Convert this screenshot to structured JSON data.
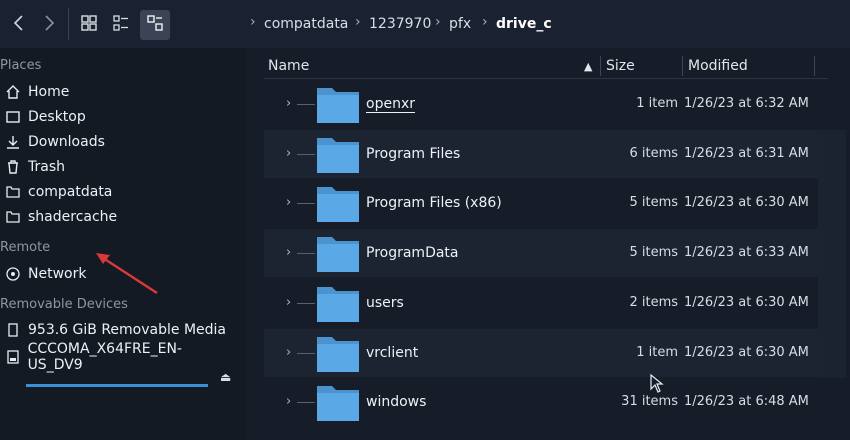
{
  "toolbar": {
    "back_icon": "chevron-left",
    "forward_icon": "chevron-right",
    "view_icons_icon": "icons-view",
    "view_compact_icon": "compact-view",
    "view_details_icon": "details-view"
  },
  "breadcrumb": [
    "compatdata",
    "1237970",
    "pfx",
    "drive_c"
  ],
  "sidebar": {
    "places_title": "Places",
    "places": [
      {
        "label": "Home",
        "icon": "home-icon"
      },
      {
        "label": "Desktop",
        "icon": "desktop-icon"
      },
      {
        "label": "Downloads",
        "icon": "downloads-icon"
      },
      {
        "label": "Trash",
        "icon": "trash-icon"
      },
      {
        "label": "compatdata",
        "icon": "folder-icon"
      },
      {
        "label": "shadercache",
        "icon": "folder-icon"
      }
    ],
    "remote_title": "Remote",
    "remote": [
      {
        "label": "Network",
        "icon": "network-icon"
      }
    ],
    "devices_title": "Removable Devices",
    "devices": [
      {
        "label": "953.6 GiB Removable Media",
        "icon": "drive-icon",
        "usage": 1.0
      },
      {
        "label": "CCCOMA_X64FRE_EN-US_DV9",
        "icon": "disc-icon"
      }
    ]
  },
  "columns": {
    "name": "Name",
    "size": "Size",
    "modified": "Modified"
  },
  "files": [
    {
      "name": "openxr",
      "size": "1 item",
      "modified": "1/26/23 at 6:32 AM"
    },
    {
      "name": "Program Files",
      "size": "6 items",
      "modified": "1/26/23 at 6:31 AM"
    },
    {
      "name": "Program Files (x86)",
      "size": "5 items",
      "modified": "1/26/23 at 6:30 AM"
    },
    {
      "name": "ProgramData",
      "size": "5 items",
      "modified": "1/26/23 at 6:33 AM"
    },
    {
      "name": "users",
      "size": "2 items",
      "modified": "1/26/23 at 6:30 AM"
    },
    {
      "name": "vrclient",
      "size": "1 item",
      "modified": "1/26/23 at 6:30 AM"
    },
    {
      "name": "windows",
      "size": "31 items",
      "modified": "1/26/23 at 6:48 AM"
    }
  ],
  "colors": {
    "accent": "#3a8fd6",
    "folder": "#5aa9e6",
    "annotation": "#d83a3a"
  }
}
